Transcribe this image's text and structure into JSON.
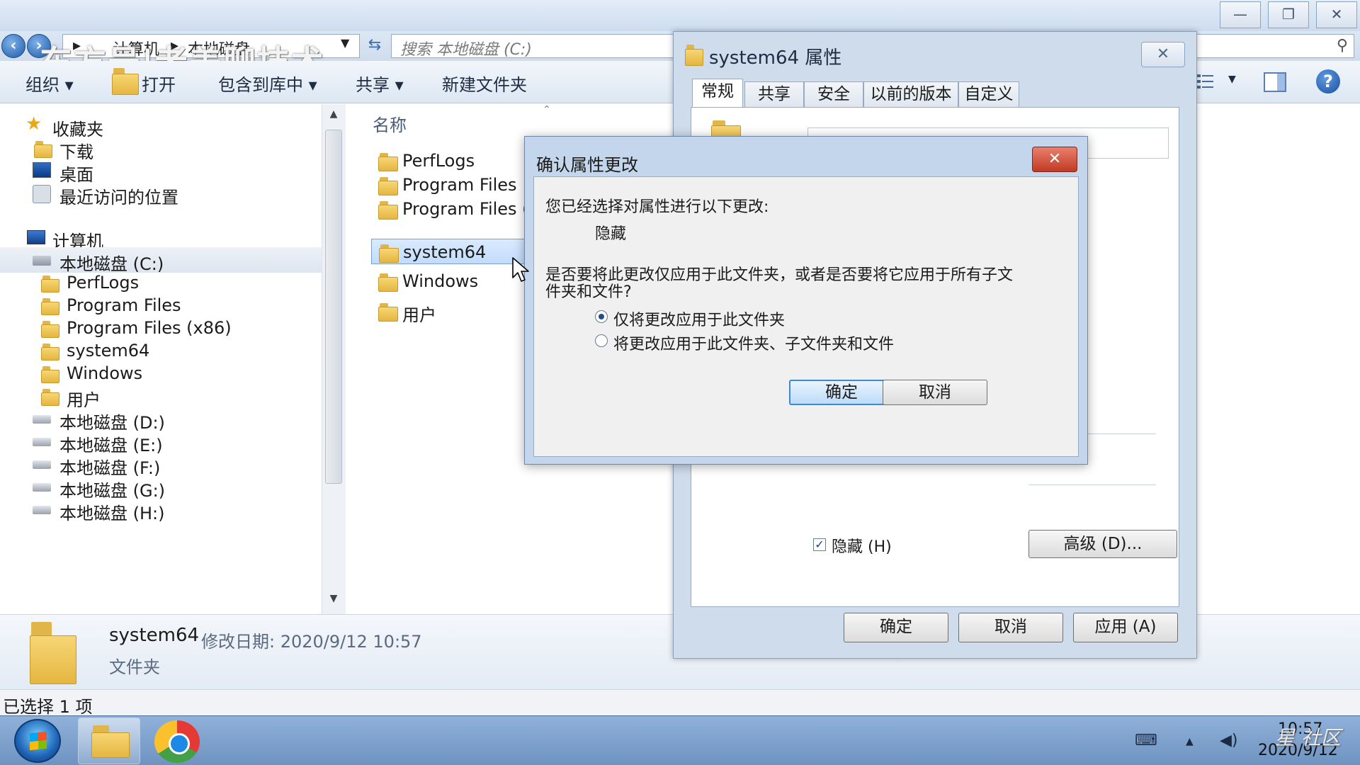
{
  "watermark": "东方号|老盖聊技术",
  "explorer": {
    "address": [
      "计算机",
      "本地磁盘"
    ],
    "search_placeholder": "搜索 本地磁盘 (C:)",
    "toolbar": {
      "organize": "组织 ▾",
      "open": "打开",
      "include_library": "包含到库中 ▾",
      "share": "共享 ▾",
      "new_folder": "新建文件夹"
    },
    "nav": {
      "favorites": "收藏夹",
      "downloads": "下载",
      "desktop": "桌面",
      "recent": "最近访问的位置",
      "computer": "计算机",
      "drive_c": "本地磁盘 (C:)",
      "c_children": [
        "PerfLogs",
        "Program Files",
        "Program Files (x86)",
        "system64",
        "Windows",
        "用户"
      ],
      "drives": [
        "本地磁盘 (D:)",
        "本地磁盘 (E:)",
        "本地磁盘 (F:)",
        "本地磁盘 (G:)",
        "本地磁盘 (H:)"
      ]
    },
    "column_name": "名称",
    "files": [
      "PerfLogs",
      "Program Files",
      "Program Files (",
      "system64",
      "Windows",
      "用户"
    ],
    "selected_file": "system64",
    "details": {
      "name": "system64",
      "modified": "修改日期: 2020/9/12 10:57",
      "type": "文件夹"
    },
    "status": "已选择 1 项"
  },
  "properties": {
    "title": "system64 属性",
    "tabs": [
      "常规",
      "共享",
      "安全",
      "以前的版本",
      "自定义"
    ],
    "active_tab": "常规",
    "hidden_label": "隐藏 (H)",
    "advanced": "高级 (D)...",
    "ok": "确定",
    "cancel": "取消",
    "apply": "应用 (A)"
  },
  "confirm": {
    "title": "确认属性更改",
    "intro": "您已经选择对属性进行以下更改:",
    "change": "隐藏",
    "question_line1": "是否要将此更改仅应用于此文件夹，或者是否要将它应用于所有子文",
    "question_line2": "件夹和文件?",
    "option_this": "仅将更改应用于此文件夹",
    "option_all": "将更改应用于此文件夹、子文件夹和文件",
    "selected_option": "option_this",
    "ok": "确定",
    "cancel": "取消"
  },
  "taskbar": {
    "time": "10:57",
    "date": "2020/9/12"
  },
  "corner_watermark": "星 社区",
  "colors": {
    "accent": "#3b8ad6",
    "close_red": "#c13a24",
    "selection": "#c3dcfb"
  }
}
